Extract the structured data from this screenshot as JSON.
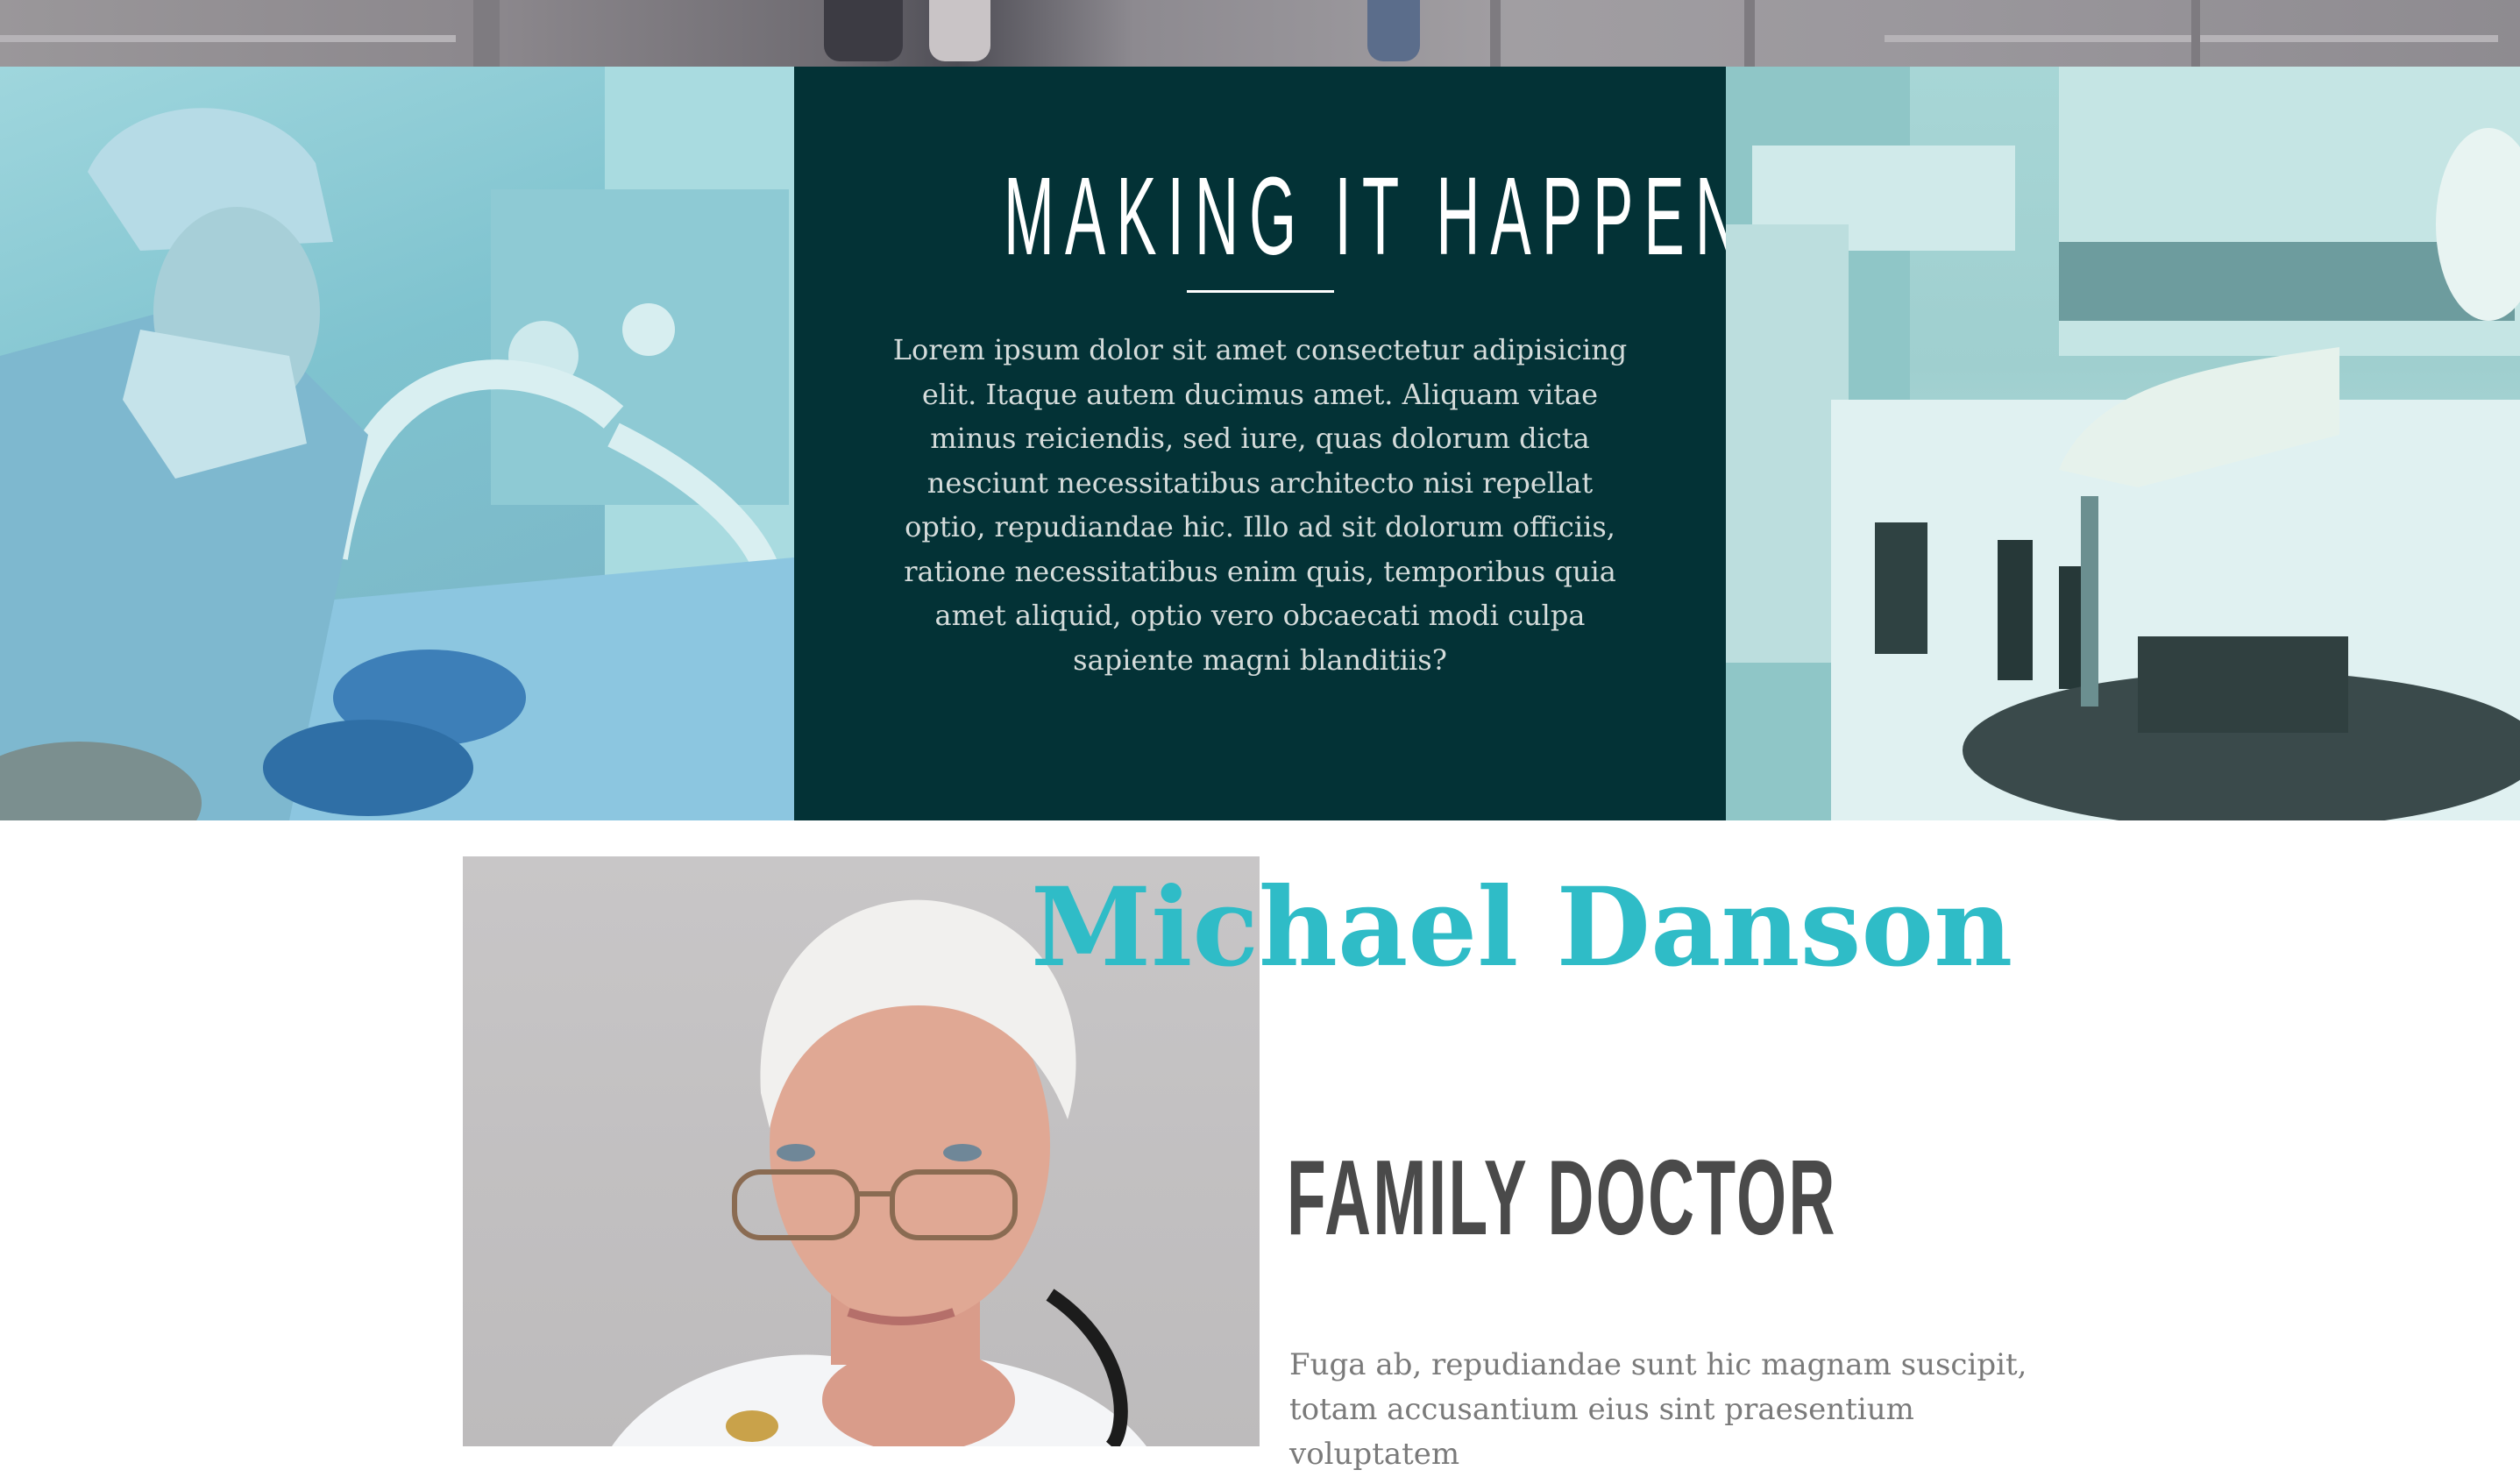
{
  "feature": {
    "title": "MAKING IT HAPPEN",
    "body": "Lorem ipsum dolor sit amet consectetur adipisicing elit. Itaque autem ducimus amet. Aliquam vitae minus reiciendis, sed iure, quas dolorum dicta nesciunt necessitatibus architecto nisi repellat optio, repudiandae hic. Illo ad sit dolorum officiis, ratione necessitatibus enim quis, temporibus quia amet aliquid, optio vero obcaecati modi culpa sapiente magni blanditiis?"
  },
  "doctor": {
    "name": "Michael Danson",
    "role": "FAMILY DOCTOR",
    "bio": "Fuga ab, repudiandae sunt hic magnam suscipit, totam accusantium eius sint praesentium voluptatem"
  },
  "colors": {
    "panel_bg": "#033236",
    "accent": "#2fbcc7",
    "role_text": "#4a4a4a",
    "body_text": "#7a7a7a"
  }
}
